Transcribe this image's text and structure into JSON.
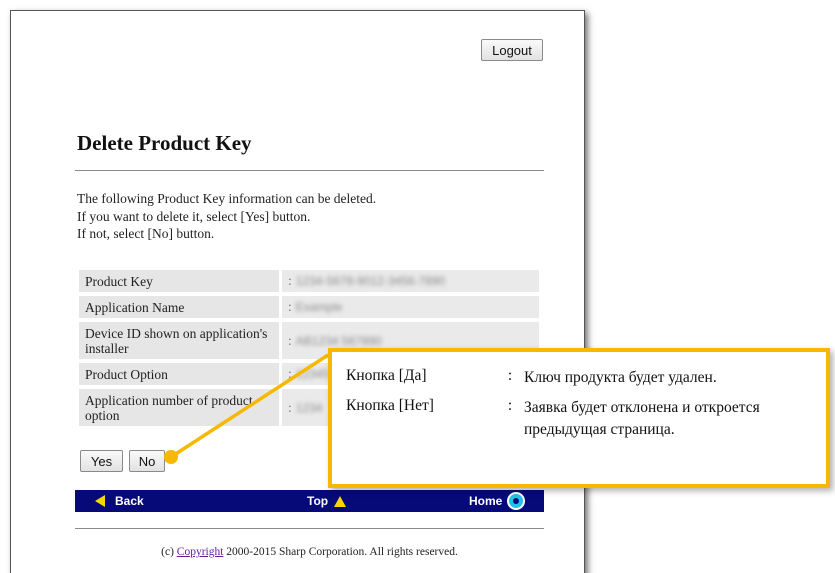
{
  "header": {
    "logout_label": "Logout"
  },
  "page": {
    "title": "Delete Product Key",
    "intro": [
      "The following Product Key information can be deleted.",
      "If you want to delete it, select [Yes] button.",
      "If not, select [No] button."
    ]
  },
  "details": [
    {
      "label": "Product Key",
      "value": "1234-5678-9012-3456-7890"
    },
    {
      "label": "Application Name",
      "value": "Example"
    },
    {
      "label": "Device ID shown on application's installer",
      "value": "AB1234 567890"
    },
    {
      "label": "Product Option",
      "value": "12345"
    },
    {
      "label": "Application number of product option",
      "value": "1234"
    }
  ],
  "separator": ":",
  "buttons": {
    "yes_label": "Yes",
    "no_label": "No"
  },
  "nav": {
    "back_label": "Back",
    "top_label": "Top",
    "home_label": "Home"
  },
  "footer": {
    "prefix": "(c) ",
    "link": "Copyright",
    "suffix": " 2000-2015 Sharp Corporation. All rights reserved."
  },
  "callout": {
    "yes_label": "Кнопка [Да]",
    "yes_text": "Ключ продукта будет удален.",
    "no_label": "Кнопка [Нет]",
    "no_text": "Заявка будет отклонена и откроется предыдущая страница.",
    "colon": ":"
  },
  "colors": {
    "nav_bar": "#050a78",
    "callout_border": "#f6b800",
    "nav_arrow": "#f5d800",
    "home_icon": "#1ec3e6",
    "copyright_link": "#6a1b9a"
  },
  "icons": {
    "back": "triangle-left-icon",
    "top": "triangle-up-icon",
    "home": "home-circle-icon"
  }
}
